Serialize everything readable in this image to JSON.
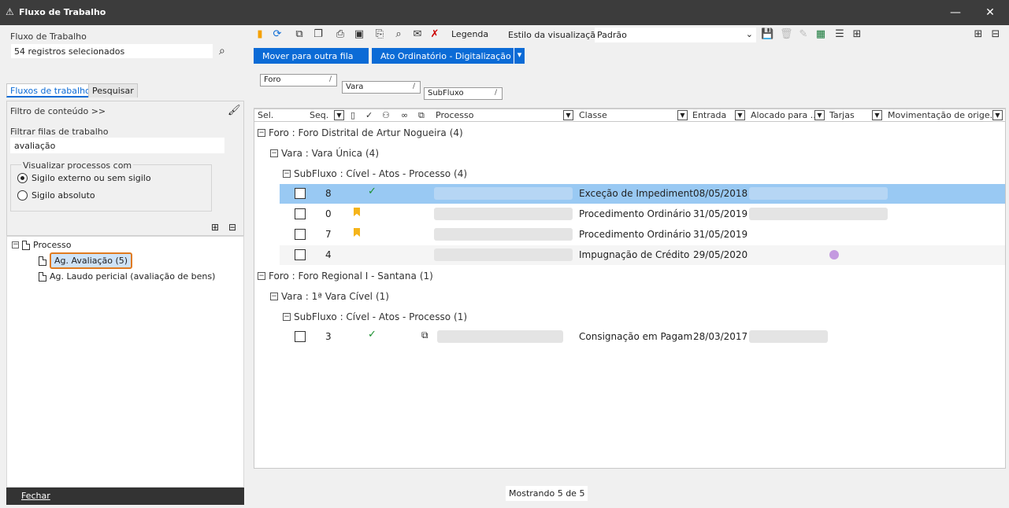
{
  "window": {
    "title": "Fluxo de Trabalho",
    "minimize": "—",
    "close": "✕"
  },
  "left": {
    "fluxo_label": "Fluxo de Trabalho",
    "fluxo_value": "54 registros selecionados",
    "tabs": [
      "Fluxos de trabalho",
      "Pesquisar"
    ],
    "filtro_conteudo": "Filtro de conteúdo >>",
    "filtrar_label": "Filtrar filas de trabalho",
    "filtrar_value": "avaliação",
    "visualizar_label": "Visualizar processos com",
    "radio1": "Sigilo externo ou sem sigilo",
    "radio2": "Sigilo absoluto",
    "tree_root": "Processo",
    "tree_node1": "Ag. Avaliação (5)",
    "tree_node2": "Ag. Laudo pericial (avaliação de bens)",
    "fechar": "Fechar",
    "tree_minus": "−"
  },
  "toolbar": {
    "legenda": "Legenda",
    "estilo_label": "Estilo da visualização",
    "estilo_value": "Padrão",
    "btn_mover": "Mover para outra fila",
    "btn_ato": "Ato Ordinatório - Digitalização"
  },
  "grouping": {
    "foro": "Foro",
    "vara": "Vara",
    "subfluxo": "SubFluxo",
    "sort_mark": "/"
  },
  "grid": {
    "headers": {
      "sel": "Sel.",
      "seq": "Seq.",
      "processo": "Processo",
      "classe": "Classe",
      "entrada": "Entrada",
      "alocado": "Alocado para ...",
      "tarjas": "Tarjas",
      "mov": "Movimentação de orige..."
    },
    "groups": [
      {
        "foro": "Foro : Foro Distrital de Artur Nogueira",
        "foro_count": "(4)",
        "vara": "Vara : Vara Única",
        "vara_count": "(4)",
        "sub": "SubFluxo : Cível - Atos - Processo",
        "sub_count": "(4)"
      },
      {
        "foro": "Foro : Foro Regional I - Santana",
        "foro_count": "(1)",
        "vara": "Vara : 1ª Vara Cível",
        "vara_count": "(1)",
        "sub": "SubFluxo : Cível - Atos - Processo",
        "sub_count": "(1)"
      }
    ],
    "rows": [
      {
        "seq": "8",
        "classe": "Exceção de Impediment",
        "entrada": "08/05/2018"
      },
      {
        "seq": "0",
        "classe": "Procedimento Ordinário",
        "entrada": "31/05/2019"
      },
      {
        "seq": "7",
        "classe": "Procedimento Ordinário",
        "entrada": "31/05/2019"
      },
      {
        "seq": "4",
        "classe": "Impugnação de Crédito",
        "entrada": "29/05/2020"
      },
      {
        "seq": "3",
        "classe": "Consignação em Pagam",
        "entrada": "28/03/2017"
      }
    ]
  },
  "status": {
    "showing": "Mostrando 5 de 5"
  },
  "colors": {
    "accent": "#0b6bd6",
    "selection": "#99c9f3",
    "highlight_border": "#e07b20"
  }
}
